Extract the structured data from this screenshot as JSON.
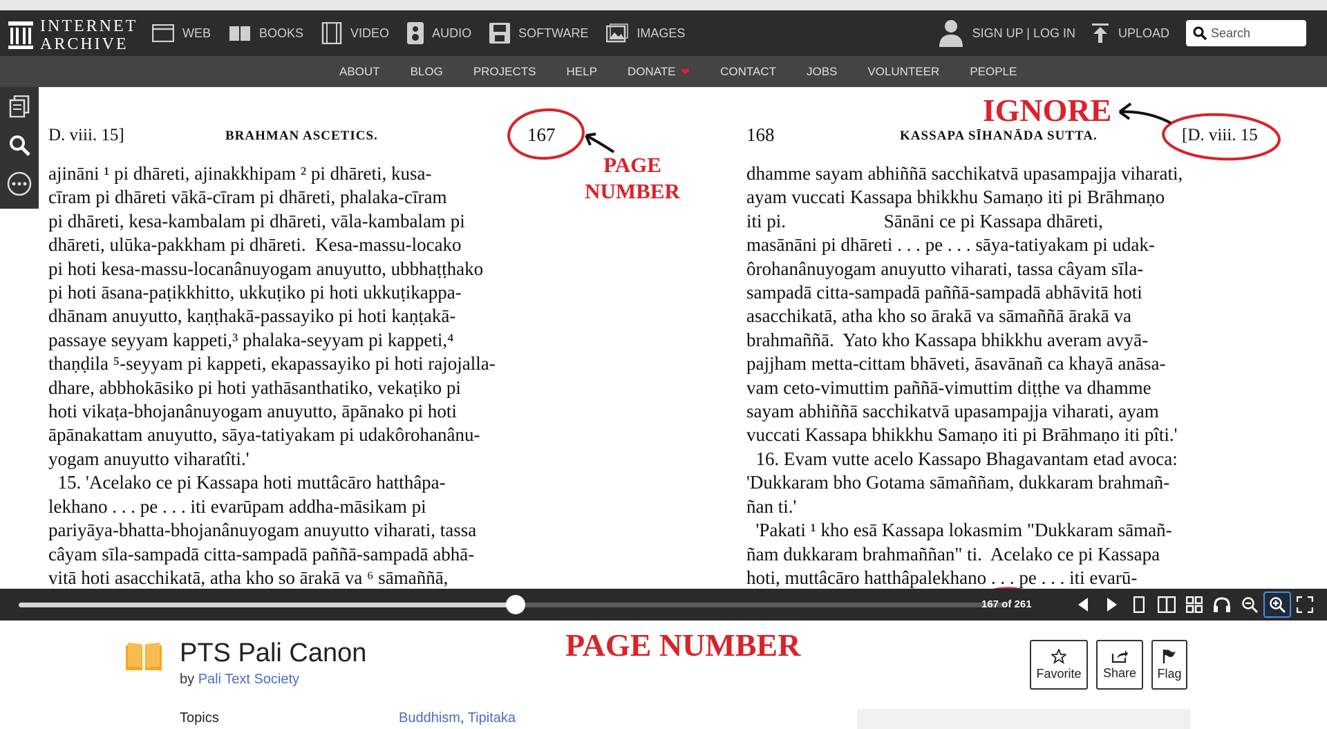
{
  "header": {
    "logo_line1": "INTERNET",
    "logo_line2": "ARCHIVE",
    "nav": [
      {
        "label": "WEB",
        "icon": "web-icon"
      },
      {
        "label": "BOOKS",
        "icon": "books-icon"
      },
      {
        "label": "VIDEO",
        "icon": "video-icon"
      },
      {
        "label": "AUDIO",
        "icon": "audio-icon"
      },
      {
        "label": "SOFTWARE",
        "icon": "software-icon"
      },
      {
        "label": "IMAGES",
        "icon": "images-icon"
      }
    ],
    "signin": "SIGN UP | LOG IN",
    "upload": "UPLOAD",
    "search_placeholder": "Search"
  },
  "subnav": [
    "ABOUT",
    "BLOG",
    "PROJECTS",
    "HELP",
    "DONATE",
    "CONTACT",
    "JOBS",
    "VOLUNTEER",
    "PEOPLE"
  ],
  "book": {
    "left": {
      "ref": "D. viii. 15]",
      "title": "BRAHMAN ASCETICS.",
      "number": "167",
      "lines": [
        "ajināni ¹ pi dhāreti, ajinakkhipam ² pi dhāreti, kusa-",
        "cīram pi dhāreti vākā-cīram pi dhāreti, phalaka-cīram",
        "pi dhāreti, kesa-kambalam pi dhāreti, vāla-kambalam pi",
        "dhāreti, ulūka-pakkham pi dhāreti.  Kesa-massu-locako",
        "pi hoti kesa-massu-locanânuyogam anuyutto, ubbhaṭṭhako",
        "pi hoti āsana-paṭikkhitto, ukkuṭiko pi hoti ukkuṭikappa-",
        "dhānam anuyutto, kaṇṭhakā-passayiko pi hoti kaṇṭakā-",
        "passaye seyyam kappeti,³ phalaka-seyyam pi kappeti,⁴",
        "thaṇḍila ⁵-seyyam pi kappeti, ekapassayiko pi hoti rajojalla-",
        "dhare, abbhokāsiko pi hoti yathāsanthatiko, vekaṭiko pi",
        "hoti vikaṭa-bhojanânuyogam anuyutto, āpānako pi hoti",
        "āpānakattam anuyutto, sāya-tatiyakam pi udakôrohanânu-",
        "yogam anuyutto viharatîti.'",
        "  15. 'Acelako ce pi Kassapa hoti muttâcāro hatthâpa-",
        "lekhano . . . pe . . . iti evarūpam addha-māsikam pi",
        "pariyāya-bhatta-bhojanânuyogam anuyutto viharati, tassa",
        "câyam sīla-sampadā citta-sampadā paññā-sampadā abhā-",
        "vitā hoti asacchikatā, atha kho so ārakā va ⁶ sāmaññā,"
      ]
    },
    "right": {
      "number": "168",
      "title": "KASSAPA SĪHANĀDA SUTTA.",
      "ref": "[D. viii. 15",
      "lines": [
        "dhamme sayam abhiññā sacchikatvā upasampajja viharati,",
        "ayam vuccati Kassapa bhikkhu Samaṇo iti pi Brāhmaṇo",
        "iti pi.                     Sānāni ce pi Kassapa dhāreti,",
        "masānāni pi dhāreti . . . pe . . . sāya-tatiyakam pi udak-",
        "ôrohanânuyogam anuyutto viharati, tassa câyam sīla-",
        "sampadā citta-sampadā paññā-sampadā abhāvitā hoti",
        "asacchikatā, atha kho so ārakā va sāmaññā ārakā va",
        "brahmaññā.  Yato kho Kassapa bhikkhu averam avyā-",
        "pajjham metta-cittam bhāveti, āsavānañ ca khayā anāsa-",
        "vam ceto-vimuttim paññā-vimuttim diṭṭhe va dhamme",
        "sayam abhiññā sacchikatvā upasampajja viharati, ayam",
        "vuccati Kassapa bhikkhu Samaṇo iti pi Brāhmaṇo iti pîti.'",
        "  16. Evam vutte acelo Kassapo Bhagavantam etad avoca:",
        "'Dukkaram bho Gotama sāmaññam, dukkaram brahmañ-",
        "ñan ti.'",
        "  'Pakati ¹ kho esā Kassapa lokasmim \"Dukkaram sāmañ-",
        "ñam dukkaram brahmaññan\" ti.  Acelako ce pi Kassapa",
        "hoti, muttâcāro hatthâpalekhano . . . pe . . . iti evarū-"
      ]
    }
  },
  "annotations": {
    "page_number_top": "PAGE\nNUMBER",
    "ignore": "IGNORE",
    "page_number_bottom": "PAGE NUMBER"
  },
  "controls": {
    "page_counter": "167 of 261",
    "progress": 0.503
  },
  "item": {
    "title": "PTS Pali Canon",
    "by_prefix": "by",
    "author": "Pali Text Society",
    "topics_label": "Topics",
    "topic1": "Buddhism",
    "topic_sep": ", ",
    "topic2": "Tipitaka",
    "favorite": "Favorite",
    "share": "Share",
    "flag": "Flag"
  },
  "colors": {
    "annotation_red": "#d8232a",
    "nav_bg": "#2c2c2c",
    "subnav_bg": "#444444",
    "link_blue": "#4b6cc7",
    "book_orange": "#f5a623"
  }
}
